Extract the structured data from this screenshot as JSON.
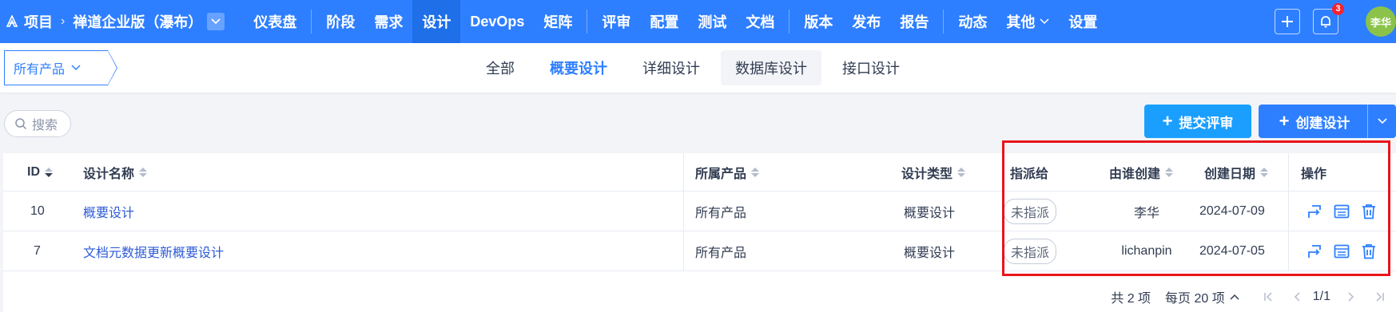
{
  "topnav": {
    "crumbs": [
      "项目",
      "禅道企业版（瀑布）"
    ],
    "groups": [
      [
        "仪表盘"
      ],
      [
        "阶段",
        "需求",
        "设计",
        "DevOps",
        "矩阵"
      ],
      [
        "评审",
        "配置",
        "测试",
        "文档"
      ],
      [
        "版本",
        "发布",
        "报告"
      ],
      [
        "动态",
        "其他",
        "设置"
      ]
    ],
    "active": "设计",
    "notification_count": "3",
    "avatar_text": "李华",
    "colors": {
      "bar": "#2e7fff",
      "active": "#1f6fe8",
      "badge": "#f5222d",
      "avatar": "#8bc34a"
    }
  },
  "subnav": {
    "product_select": "所有产品",
    "tabs": [
      "全部",
      "概要设计",
      "详细设计",
      "数据库设计",
      "接口设计"
    ],
    "active_tab": "概要设计",
    "hover_tab": "数据库设计"
  },
  "toolbar": {
    "search_label": "搜索",
    "submit_review_label": "提交评审",
    "create_design_label": "创建设计"
  },
  "table": {
    "columns": [
      "ID",
      "设计名称",
      "所属产品",
      "设计类型",
      "指派给",
      "由谁创建",
      "创建日期",
      "操作"
    ],
    "rows": [
      {
        "id": "10",
        "name": "概要设计",
        "product": "所有产品",
        "type": "概要设计",
        "assigned": "未指派",
        "creator": "李华",
        "date": "2024-07-09"
      },
      {
        "id": "7",
        "name": "文档元数据更新概要设计",
        "product": "所有产品",
        "type": "概要设计",
        "assigned": "未指派",
        "creator": "lichanpin",
        "date": "2024-07-05"
      }
    ]
  },
  "pager": {
    "total": "共 2 项",
    "per_page": "每页 20 项",
    "page": "1/1"
  },
  "accent_colors": {
    "link": "#2e5bd8",
    "highlight_box": "#e8141a",
    "submit_button": "#1a9fff",
    "create_button": "#2e7fff"
  }
}
